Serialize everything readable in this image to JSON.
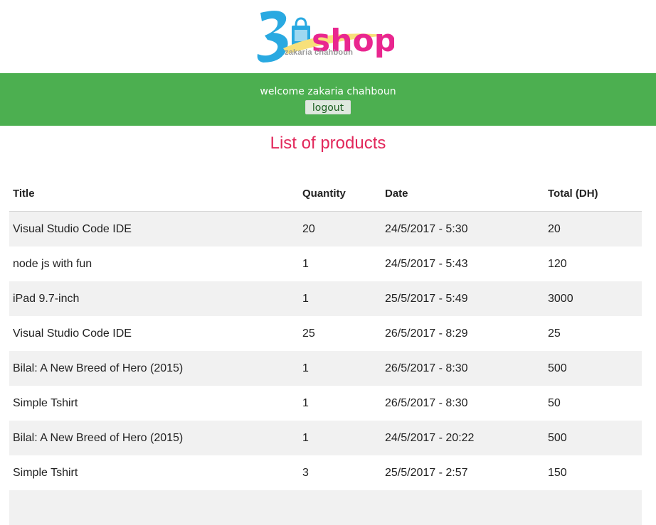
{
  "brand": {
    "logo_main": "shop",
    "logo_subtitle": "zakaria chahboun",
    "colors": {
      "blue": "#29a9e1",
      "pink": "#e9268f",
      "yellow": "#f7e07a"
    }
  },
  "header_bar": {
    "welcome_text": "welcome zakaria chahboun",
    "logout_label": "logout",
    "color": "#4caf50"
  },
  "page": {
    "title": "List of products",
    "title_color": "#e2285b"
  },
  "table": {
    "columns": [
      "Title",
      "Quantity",
      "Date",
      "Total (DH)"
    ],
    "rows": [
      [
        "Visual Studio Code IDE",
        "20",
        "24/5/2017 - 5:30",
        "20"
      ],
      [
        "node js with fun",
        "1",
        "24/5/2017 - 5:43",
        "120"
      ],
      [
        "iPad 9.7-inch",
        "1",
        "25/5/2017 - 5:49",
        "3000"
      ],
      [
        "Visual Studio Code IDE",
        "25",
        "26/5/2017 - 8:29",
        "25"
      ],
      [
        "Bilal: A New Breed of Hero (2015)",
        "1",
        "26/5/2017 - 8:30",
        "500"
      ],
      [
        "Simple Tshirt",
        "1",
        "26/5/2017 - 8:30",
        "50"
      ],
      [
        "Bilal: A New Breed of Hero (2015)",
        "1",
        "24/5/2017 - 20:22",
        "500"
      ],
      [
        "Simple Tshirt",
        "3",
        "25/5/2017 - 2:57",
        "150"
      ]
    ]
  }
}
